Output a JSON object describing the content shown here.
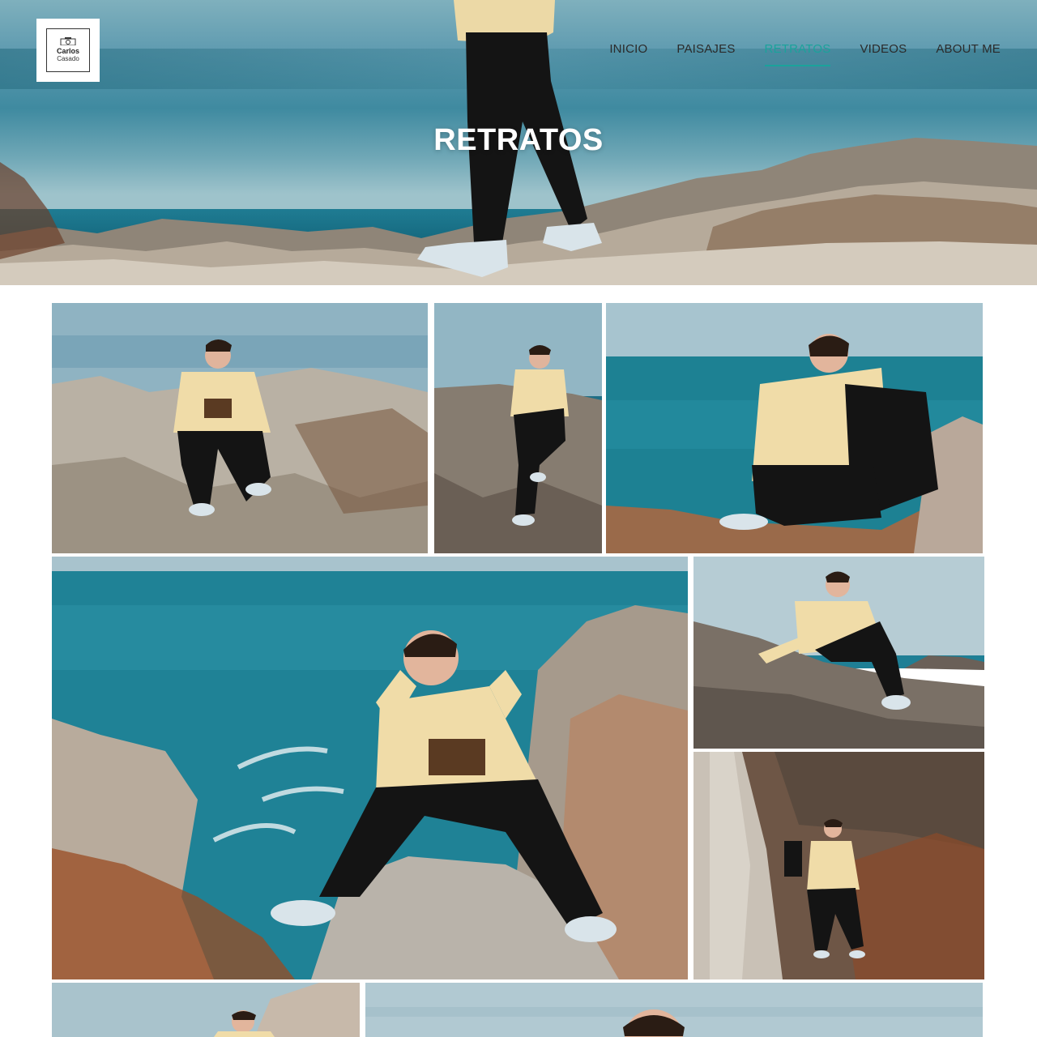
{
  "logo": {
    "line1": "Carlos",
    "line2": "Casado"
  },
  "nav": {
    "items": [
      {
        "label": "INICIO",
        "active": false
      },
      {
        "label": "PAISAJES",
        "active": false
      },
      {
        "label": "RETRATOS",
        "active": true
      },
      {
        "label": "VIDEOS",
        "active": false
      },
      {
        "label": "ABOUT ME",
        "active": false
      }
    ]
  },
  "hero": {
    "title": "RETRATOS"
  },
  "colors": {
    "accent": "#1aa39b",
    "nav_text": "#2b2b2b",
    "hoodie": "#f0dca8",
    "sea": "#1f7f95"
  },
  "gallery": {
    "photos": [
      {
        "subject": "man-sitting-on-rocks-photo"
      },
      {
        "subject": "man-sitting-on-rock-vertical-photo"
      },
      {
        "subject": "man-with-backpack-facing-sea-photo"
      },
      {
        "subject": "man-posing-hands-over-sea-photo"
      },
      {
        "subject": "man-leaning-on-rocks-photo"
      },
      {
        "subject": "man-with-backpack-among-rocks-photo"
      },
      {
        "subject": "man-at-rocks-partial-photo"
      },
      {
        "subject": "man-portrait-partial-photo"
      }
    ]
  }
}
